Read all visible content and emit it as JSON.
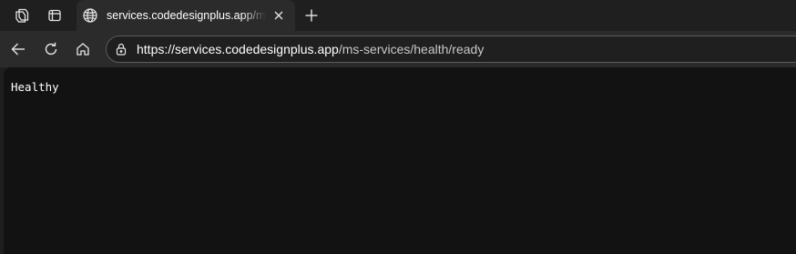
{
  "tab": {
    "title": "services.codedesignplus.app/ms-services/health/ready"
  },
  "address_bar": {
    "host": "https://services.codedesignplus.app",
    "path": "/ms-services/health/ready"
  },
  "page": {
    "body_text": "Healthy"
  },
  "icons": {
    "workspaces": "workspaces-icon",
    "tab_actions": "tab-actions-icon",
    "favicon": "globe-icon",
    "close": "close-icon",
    "new_tab": "plus-icon",
    "back": "back-arrow-icon",
    "refresh": "refresh-icon",
    "home": "home-icon",
    "site_info": "lock-icon"
  }
}
